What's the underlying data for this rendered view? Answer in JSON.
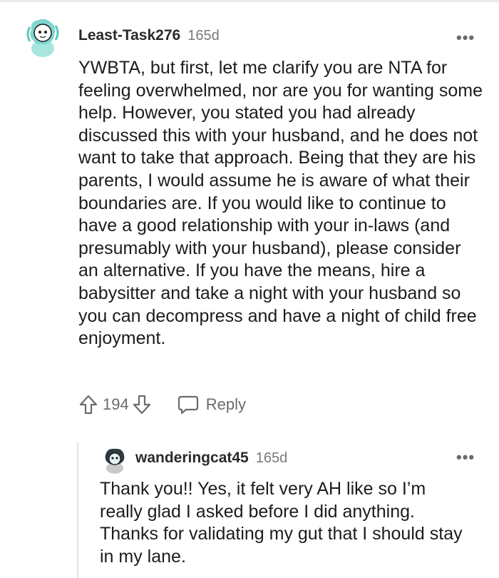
{
  "comments": [
    {
      "author": "Least-Task276",
      "age": "165d",
      "more": "•••",
      "body": "YWBTA, but first, let me clarify you are NTA for feeling overwhelmed, nor are you for wanting some help. However, you stated you had already discussed this with your husband, and he does not want to take that approach. Being that they are his parents, I would assume he is aware of what their boundaries are. If you would like to continue to have a good relationship with your in-laws (and presumably with your husband), please consider an alternative. If you have the means, hire a babysitter and take a night with your husband so you can decompress and have a night of child free enjoyment.",
      "score": "194",
      "reply_label": "Reply",
      "avatar_icon": "snoo-avatar-teal"
    },
    {
      "author": "wanderingcat45",
      "age": "165d",
      "more": "•••",
      "body": "Thank you!! Yes, it felt very AH like so I’m really glad I asked before I did anything. Thanks for validating my gut that I should stay in my lane.",
      "avatar_icon": "snoo-avatar-dark"
    }
  ],
  "colors": {
    "text": "#1c1c1c",
    "muted": "#7a7a7a",
    "thread_line": "#e2e2e2",
    "avatar_teal": "#8fdcd6"
  }
}
